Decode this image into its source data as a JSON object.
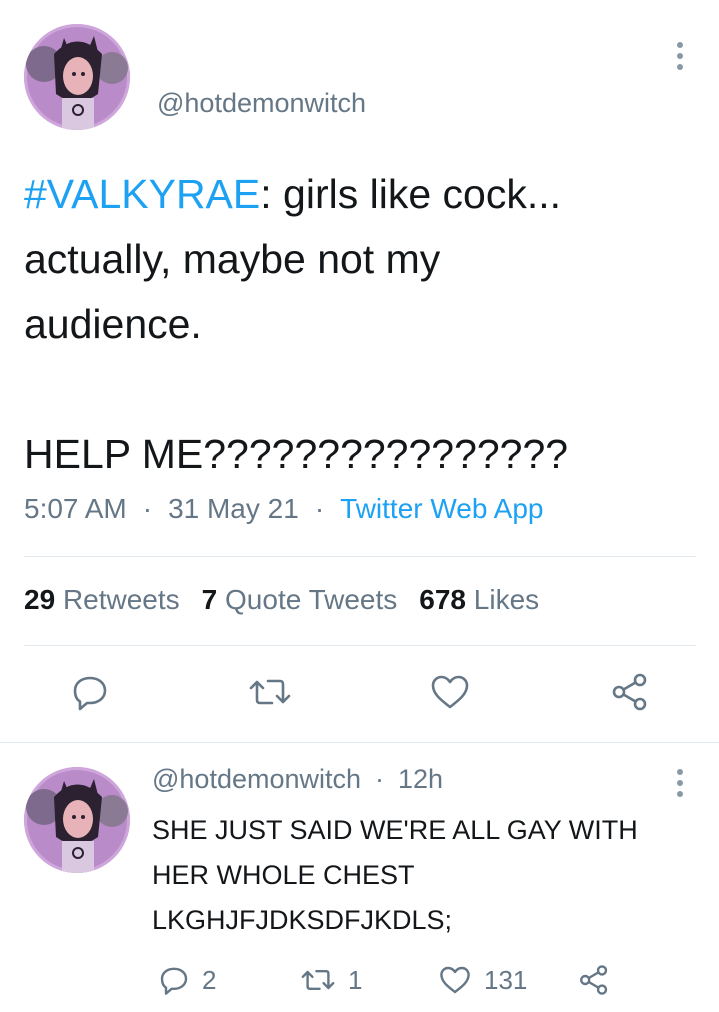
{
  "tweet": {
    "handle": "@hotdemonwitch",
    "text_hashtag": "#VALKYRAE",
    "text_line1_rest": ": girls like cock...",
    "text_line2": "actually, maybe not my",
    "text_line3": "audience.",
    "text_line5": "HELP ME????????????????",
    "time": "5:07 AM",
    "date": "31 May 21",
    "source": "Twitter Web App",
    "stats": {
      "retweets_count": "29",
      "retweets_label": "Retweets",
      "quotes_count": "7",
      "quotes_label": "Quote Tweets",
      "likes_count": "678",
      "likes_label": "Likes"
    }
  },
  "reply": {
    "handle": "@hotdemonwitch",
    "time": "12h",
    "text_line1": "SHE JUST SAID WE'RE ALL GAY WITH",
    "text_line2": "HER WHOLE CHEST",
    "text_line3": "LKGHJFJDKSDFJKDLS;",
    "reply_count": "2",
    "retweet_count": "1",
    "like_count": "131"
  },
  "icons": {
    "reply": "reply-icon",
    "retweet": "retweet-icon",
    "like": "heart-icon",
    "share": "share-icon",
    "more": "more-vertical-icon"
  },
  "colors": {
    "accent": "#1da1f2",
    "secondary_text": "#657786",
    "icon": "#657786",
    "divider": "#e1e8ed"
  }
}
